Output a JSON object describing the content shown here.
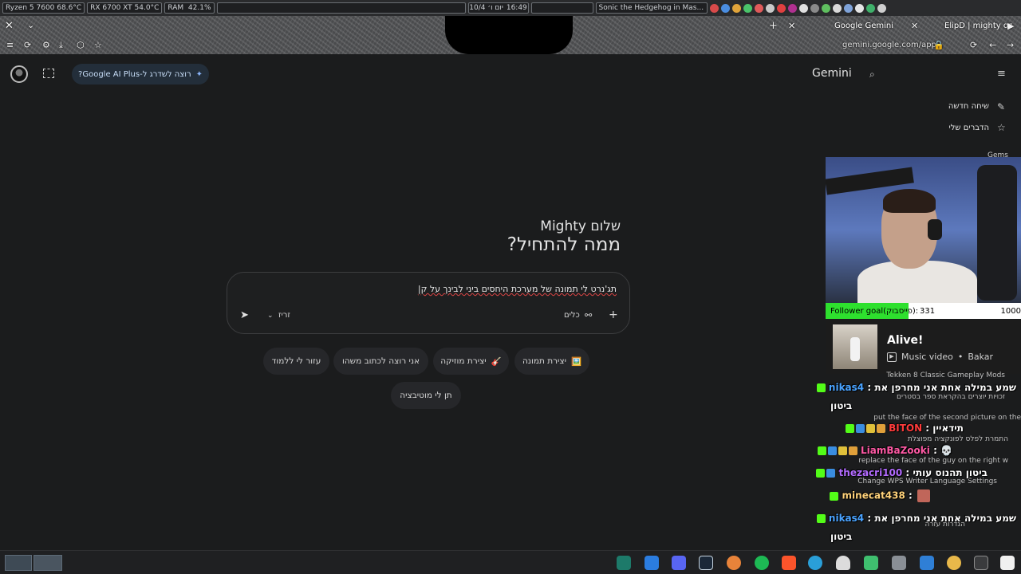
{
  "sysbar": {
    "cpu": "Ryzen 5 7600",
    "cpu_temp": "68.6°C",
    "gpu": "RX 6700 XT",
    "gpu_temp": "54.0°C",
    "ram_label": "RAM",
    "ram_value": "42.1%",
    "date": "יום ו׳ 10/4",
    "time": "16:49",
    "media": "Sonic the Hedgehog in Mas..."
  },
  "browser": {
    "tab_title": "Google Gemini",
    "tab_other": "ElipD | mighty oz",
    "url": "gemini.google.com/app"
  },
  "gemini": {
    "upgrade_label": "רוצה לשדרג ל-Google AI Plus?",
    "title": "Gemini",
    "sidebar": {
      "new_chat": "שיחה חדשה",
      "my_stuff": "הדברים שלי",
      "gems": "Gems"
    },
    "greeting_name": "שלום Mighty",
    "greeting_question": "ממה להתחיל?",
    "prompt_text": "תג'נרט לי תמונה של מערכת היחסים ביני לבינך על ק|",
    "tools_label": "כלים",
    "model_label": "זריז",
    "chips": [
      {
        "label": "יצירת תמונה",
        "icon": "🖼️"
      },
      {
        "label": "יצירת מוזיקה",
        "icon": "🎸"
      },
      {
        "label": "אני רוצה לכתוב משהו",
        "icon": ""
      },
      {
        "label": "עזור לי ללמוד",
        "icon": ""
      },
      {
        "label": "תן לי מוטיבציה",
        "icon": ""
      }
    ]
  },
  "stream": {
    "follower_goal_label": "Follower goal(פייסבוק):",
    "follower_count": "331",
    "follower_target": "1000",
    "follower_progress": 0.331,
    "music_title": "Alive!",
    "music_type": "Music video",
    "music_artist": "Bakar",
    "chat": [
      {
        "user": "nikas4",
        "color": "#4aa3ff",
        "message": "שמע במילה אחת אני מחרפן את",
        "message2": "ביטון"
      },
      {
        "user": "BITON",
        "color": "#ff3b3b",
        "message": "תידאיין"
      },
      {
        "user": "LiamBaZooki",
        "color": "#ff5aa5",
        "message": "💀"
      },
      {
        "user": "thezacri100",
        "color": "#b36bff",
        "message": "ביטון תהנוס עותי"
      },
      {
        "user": "minecat438",
        "color": "#ffd27a",
        "message": ""
      },
      {
        "user": "nikas4",
        "color": "#4aa3ff",
        "message": "שמע במילה אחת אני מחרפן את",
        "message2": "ביטון"
      }
    ],
    "ghost_lines": [
      "Tekken 8 Classic Gameplay Mods",
      "זכויות יוצרים בהקראת ספר בסטרים",
      "put the face of the second picture on the",
      "התמרת לפלס לפונקציה מפוצלת",
      "replace the face of the guy on the right w",
      "Change WPS Writer Language Settings",
      "הגדרות עזרה"
    ]
  }
}
